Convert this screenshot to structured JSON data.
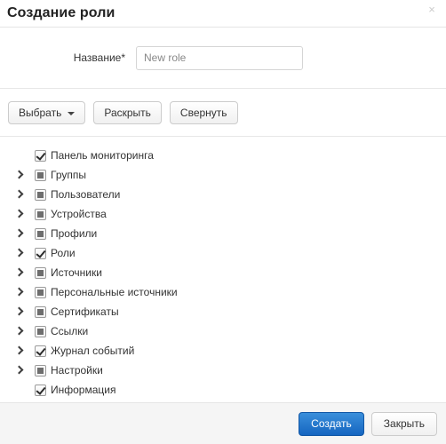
{
  "dialog": {
    "title": "Создание роли",
    "close_label": "×"
  },
  "form": {
    "name_label": "Название*",
    "name_value": "",
    "name_placeholder": "New role"
  },
  "toolbar": {
    "select_label": "Выбрать",
    "expand_label": "Раскрыть",
    "collapse_label": "Свернуть"
  },
  "tree": {
    "items": [
      {
        "label": "Панель мониторинга",
        "state": "checked",
        "expandable": false
      },
      {
        "label": "Группы",
        "state": "partial",
        "expandable": true
      },
      {
        "label": "Пользователи",
        "state": "partial",
        "expandable": true
      },
      {
        "label": "Устройства",
        "state": "partial",
        "expandable": true
      },
      {
        "label": "Профили",
        "state": "partial",
        "expandable": true
      },
      {
        "label": "Роли",
        "state": "checked",
        "expandable": true
      },
      {
        "label": "Источники",
        "state": "partial",
        "expandable": true
      },
      {
        "label": "Персональные источники",
        "state": "partial",
        "expandable": true
      },
      {
        "label": "Сертификаты",
        "state": "partial",
        "expandable": true
      },
      {
        "label": "Ссылки",
        "state": "partial",
        "expandable": true
      },
      {
        "label": "Журнал событий",
        "state": "checked",
        "expandable": true
      },
      {
        "label": "Настройки",
        "state": "partial",
        "expandable": true
      },
      {
        "label": "Информация",
        "state": "checked",
        "expandable": false
      }
    ]
  },
  "footer": {
    "create_label": "Создать",
    "close_label": "Закрыть"
  },
  "colors": {
    "primary": "#1565c0",
    "border": "#e5e5e5",
    "footer_bg": "#f5f5f5",
    "text": "#333333"
  }
}
